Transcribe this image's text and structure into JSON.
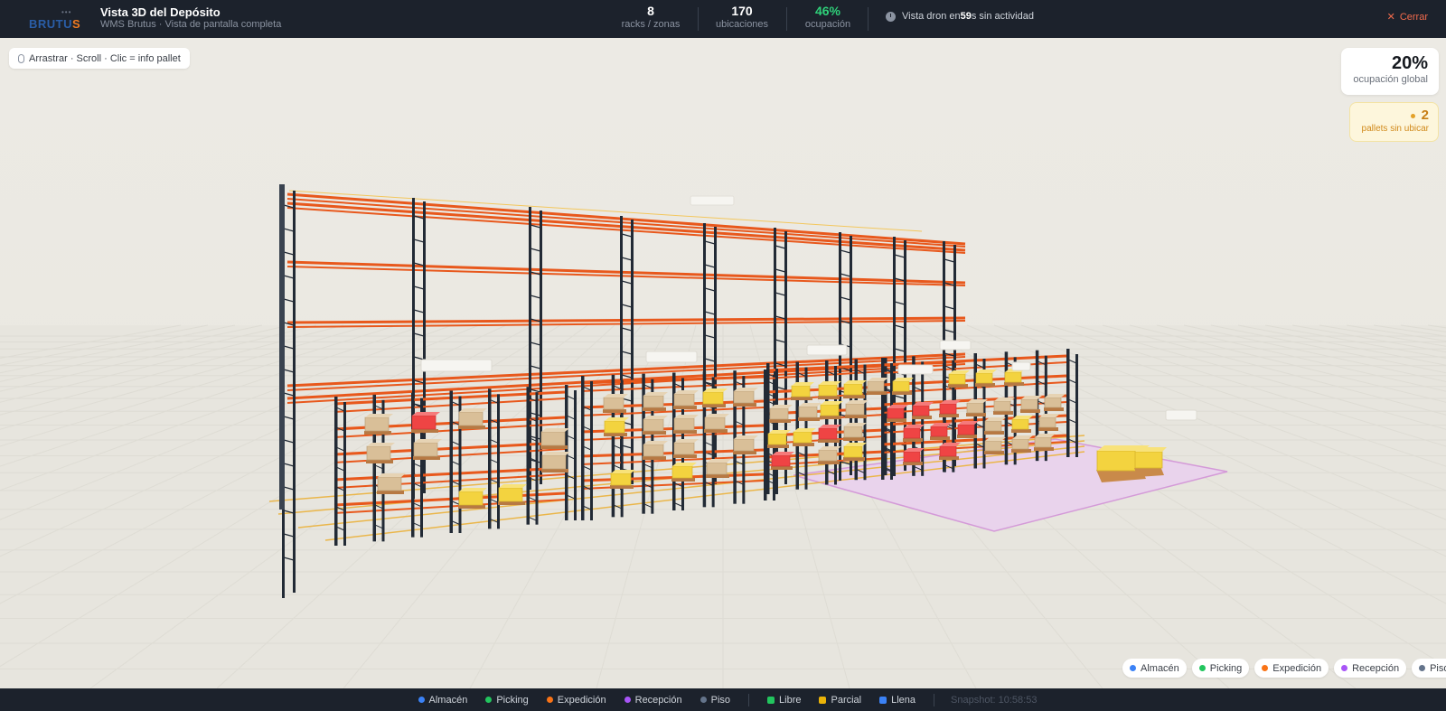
{
  "header": {
    "logo": "BRUTUS",
    "title": "Vista 3D del Depósito",
    "subtitle": "WMS Brutus · Vista de pantalla completa",
    "stats": [
      {
        "value": "8",
        "label": "racks / zonas"
      },
      {
        "value": "170",
        "label": "ubicaciones"
      },
      {
        "value": "46%",
        "label": "ocupación"
      }
    ],
    "drone_prefix": "Vista dron en ",
    "drone_seconds": "59",
    "drone_suffix": "s sin actividad",
    "close_label": "Cerrar"
  },
  "scene": {
    "hint": "Arrastrar · Scroll · Clic = info pallet",
    "global_occupancy_value": "20%",
    "global_occupancy_label": "ocupación global",
    "pending_value": "2",
    "pending_label": "pallets sin ubicar"
  },
  "zone_legend": [
    {
      "label": "Almacén",
      "color": "#3b82f6"
    },
    {
      "label": "Picking",
      "color": "#22c55e"
    },
    {
      "label": "Expedición",
      "color": "#f97316"
    },
    {
      "label": "Recepción",
      "color": "#a855f7"
    },
    {
      "label": "Piso",
      "color": "#64748b"
    }
  ],
  "status_legend": [
    {
      "label": "Libre",
      "color": "#22c55e"
    },
    {
      "label": "Parcial",
      "color": "#eab308"
    },
    {
      "label": "Llena",
      "color": "#3b82f6"
    }
  ],
  "snapshot": "Snapshot: 10:58:53",
  "colors": {
    "topbar": "#1c222c",
    "rack_frame": "#222a35",
    "rack_beam": "#e8581c",
    "pallet_partial": "#f3d33f",
    "pallet_full": "#ef4444",
    "pallet_box": "#d9bf98",
    "reception_zone": "#e9d2ec"
  }
}
